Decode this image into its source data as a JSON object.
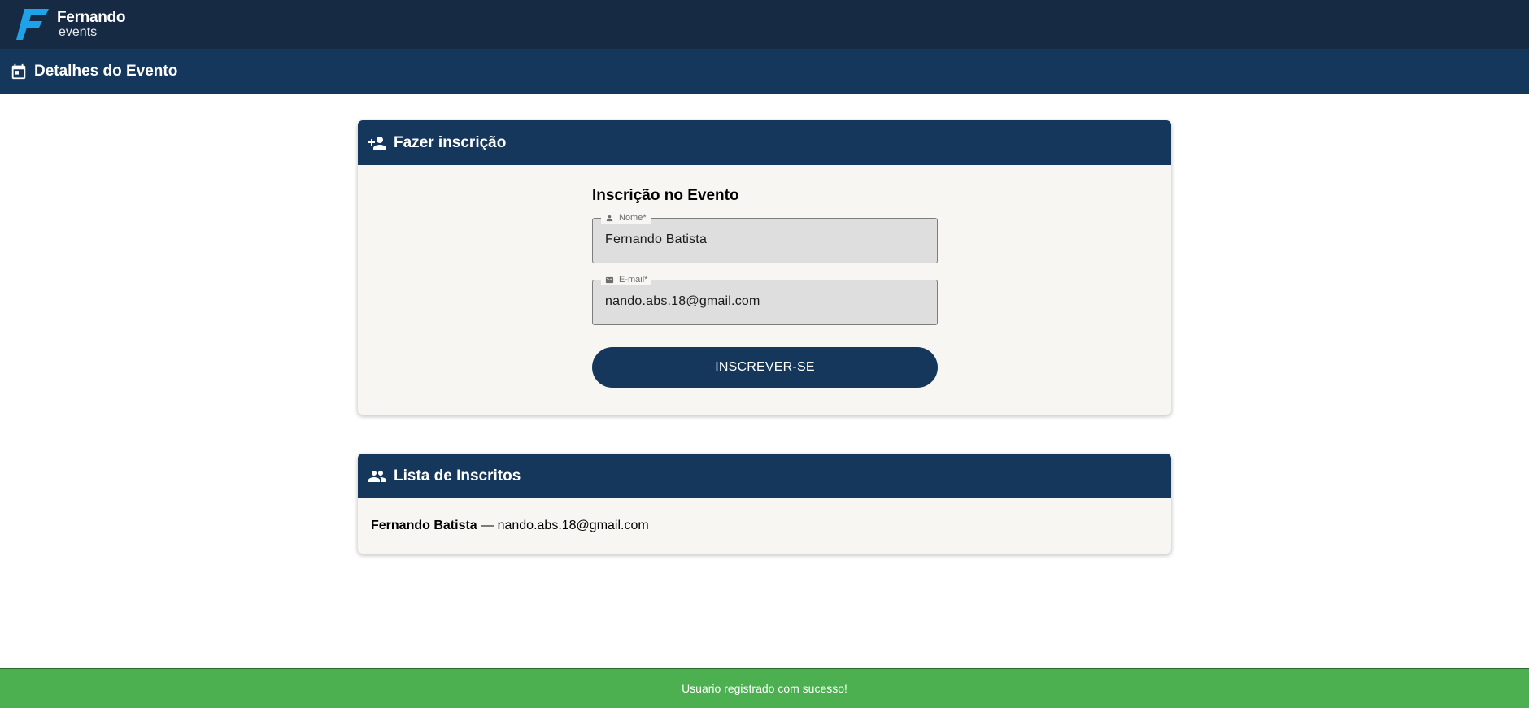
{
  "brand": {
    "name": "Fernando",
    "sub": "events",
    "icon": "logo-f-icon",
    "color": "#1fa3e8"
  },
  "header": {
    "title": "Detalhes do Evento",
    "icon": "calendar-icon"
  },
  "registration": {
    "title": "Fazer inscrição",
    "icon": "person-add-icon",
    "form_title": "Inscrição no Evento",
    "name_field": {
      "label": "Nome*",
      "value": "Fernando Batista",
      "icon": "person-icon"
    },
    "email_field": {
      "label": "E-mail*",
      "value": "nando.abs.18@gmail.com",
      "icon": "mail-icon"
    },
    "submit_label": "INSCREVER-SE"
  },
  "attendees": {
    "title": "Lista de Inscritos",
    "icon": "group-icon",
    "items": [
      {
        "name": "Fernando Batista",
        "separator": " — ",
        "email": "nando.abs.18@gmail.com"
      }
    ]
  },
  "toast": {
    "message": "Usuario registrado com sucesso!",
    "color": "#4caf50"
  },
  "colors": {
    "topbar": "#172a43",
    "accent": "#15375b",
    "card_bg": "#f8f6f3"
  }
}
